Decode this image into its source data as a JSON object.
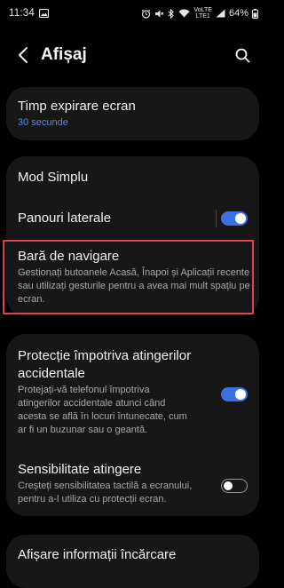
{
  "status_bar": {
    "time": "11:34",
    "battery": "64%",
    "network_top": "VoLTE",
    "network_bottom": "LTE1"
  },
  "header": {
    "title": "Afișaj"
  },
  "items": {
    "screen_timeout": {
      "title": "Timp expirare ecran",
      "value": "30 secunde"
    },
    "easy_mode": {
      "title": "Mod Simplu"
    },
    "edge_panels": {
      "title": "Panouri laterale",
      "toggle": "on"
    },
    "navigation_bar": {
      "title": "Bară de navigare",
      "description": "Gestionați butoanele Acasă, Înapoi și Aplicații recente sau utilizați gesturile pentru a avea mai mult spațiu pe ecran."
    },
    "accidental_touch": {
      "title_line1": "Protecție împotriva atingerilor",
      "title_line2": "accidentale",
      "description_lines": [
        "Protejați-vă telefonul împotriva",
        "atingerilor accidentale atunci când",
        "acesta se află în locuri întunecate, cum",
        "ar fi un buzunar sau o geantă."
      ],
      "toggle": "on"
    },
    "touch_sensitivity": {
      "title": "Sensibilitate atingere",
      "description_lines": [
        "Creșteți sensibilitatea tactilă a ecranului,",
        "pentru a-l utiliza cu protecții ecran."
      ],
      "toggle": "off"
    },
    "charging_info": {
      "title": "Afișare informații încărcare"
    }
  },
  "colors": {
    "accent_blue": "#3d6fe0",
    "link_blue": "#4f8bf0",
    "highlight_red": "#e0434c",
    "card_bg": "#171717"
  }
}
